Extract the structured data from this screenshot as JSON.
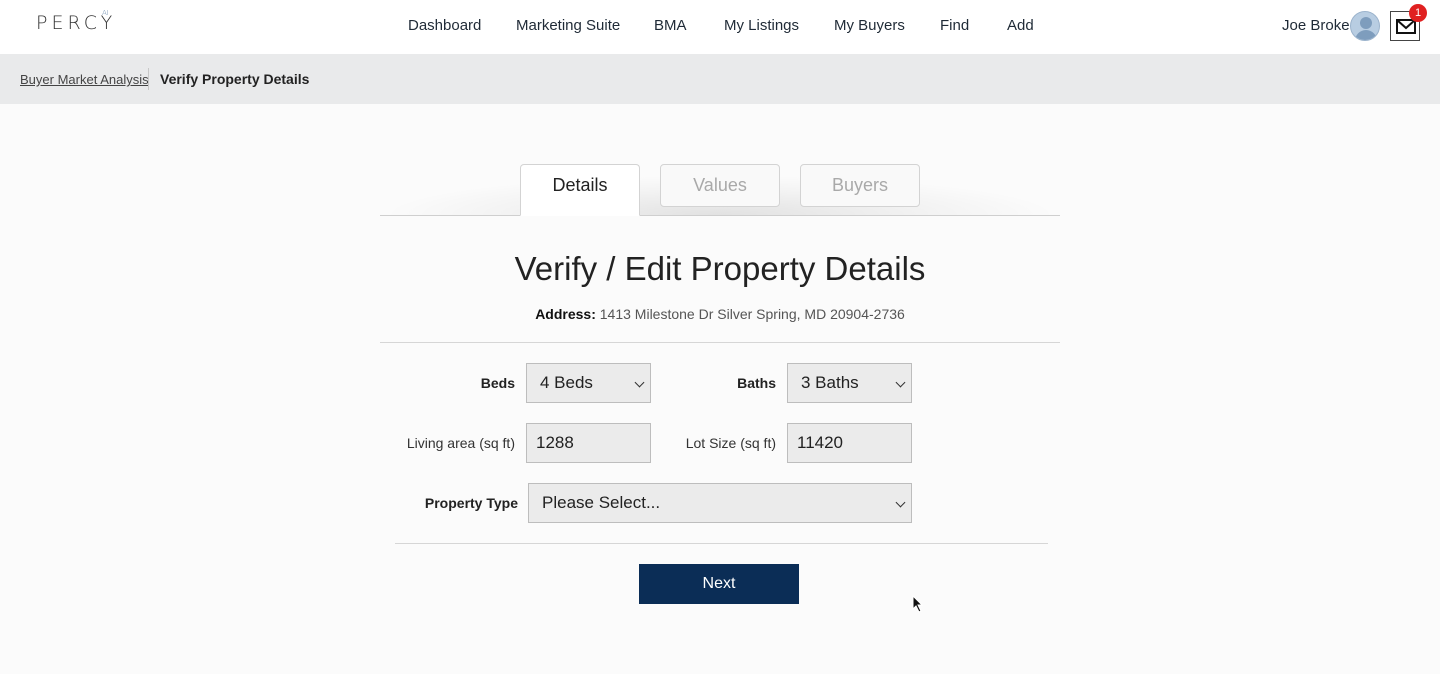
{
  "header": {
    "logo_text": "PERCY",
    "logo_superscript": "AI",
    "nav": [
      {
        "label": "Dashboard"
      },
      {
        "label": "Marketing Suite"
      },
      {
        "label": "BMA"
      },
      {
        "label": "My Listings"
      },
      {
        "label": "My Buyers"
      },
      {
        "label": "Find"
      },
      {
        "label": "Add"
      }
    ],
    "user_name": "Joe Broker",
    "notification_count": "1"
  },
  "breadcrumb": {
    "parent": "Buyer Market Analysis",
    "current": "Verify Property Details"
  },
  "tabs": [
    {
      "label": "Details",
      "active": true
    },
    {
      "label": "Values",
      "active": false
    },
    {
      "label": "Buyers",
      "active": false
    }
  ],
  "main": {
    "title": "Verify / Edit Property Details",
    "address_label": "Address:",
    "address_value": "1413 Milestone Dr Silver Spring, MD 20904-2736"
  },
  "form": {
    "beds_label": "Beds",
    "beds_value": "4 Beds",
    "baths_label": "Baths",
    "baths_value": "3 Baths",
    "living_area_label": "Living area (sq ft)",
    "living_area_value": "1288",
    "lot_size_label": "Lot Size (sq ft)",
    "lot_size_value": "11420",
    "property_type_label": "Property Type",
    "property_type_value": "Please Select...",
    "next_label": "Next"
  },
  "colors": {
    "primary_button": "#0b2d56",
    "badge": "#e02020",
    "breadcrumb_bar": "#e9eaeb"
  }
}
